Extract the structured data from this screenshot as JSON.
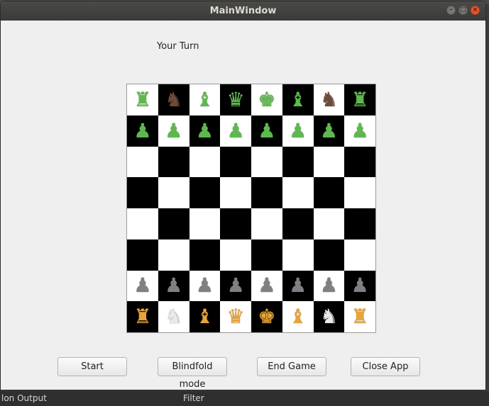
{
  "window": {
    "title": "MainWindow"
  },
  "status": {
    "turn": "Your Turn"
  },
  "buttons": {
    "start": "Start",
    "blindfold": "Blindfold mode",
    "end_game": "End Game",
    "close_app": "Close App"
  },
  "background": {
    "left_text": "lon Output",
    "filter_text": "Filter"
  },
  "colors": {
    "green_pieces": "#5fb84f",
    "gray_pieces": "#7f7f85",
    "orange_pieces": "#e6a43a",
    "dark_square": "#000000",
    "light_square": "#ffffff"
  },
  "board": {
    "rows": [
      [
        {
          "p": "rook",
          "c": "green"
        },
        {
          "p": "knight",
          "c": "brown"
        },
        {
          "p": "bishop",
          "c": "green"
        },
        {
          "p": "queen",
          "c": "green"
        },
        {
          "p": "king",
          "c": "green"
        },
        {
          "p": "bishop",
          "c": "green"
        },
        {
          "p": "knight",
          "c": "brown"
        },
        {
          "p": "rook",
          "c": "green"
        }
      ],
      [
        {
          "p": "pawn",
          "c": "green"
        },
        {
          "p": "pawn",
          "c": "green"
        },
        {
          "p": "pawn",
          "c": "green"
        },
        {
          "p": "pawn",
          "c": "green"
        },
        {
          "p": "pawn",
          "c": "green"
        },
        {
          "p": "pawn",
          "c": "green"
        },
        {
          "p": "pawn",
          "c": "green"
        },
        {
          "p": "pawn",
          "c": "green"
        }
      ],
      [
        null,
        null,
        null,
        null,
        null,
        null,
        null,
        null
      ],
      [
        null,
        null,
        null,
        null,
        null,
        null,
        null,
        null
      ],
      [
        null,
        null,
        null,
        null,
        null,
        null,
        null,
        null
      ],
      [
        null,
        null,
        null,
        null,
        null,
        null,
        null,
        null
      ],
      [
        {
          "p": "pawn",
          "c": "gray"
        },
        {
          "p": "pawn",
          "c": "gray"
        },
        {
          "p": "pawn",
          "c": "gray"
        },
        {
          "p": "pawn",
          "c": "gray"
        },
        {
          "p": "pawn",
          "c": "gray"
        },
        {
          "p": "pawn",
          "c": "gray"
        },
        {
          "p": "pawn",
          "c": "gray"
        },
        {
          "p": "pawn",
          "c": "gray"
        }
      ],
      [
        {
          "p": "rook",
          "c": "orange"
        },
        {
          "p": "knight",
          "c": "white"
        },
        {
          "p": "bishop",
          "c": "orange"
        },
        {
          "p": "queen",
          "c": "orange"
        },
        {
          "p": "king",
          "c": "orange"
        },
        {
          "p": "bishop",
          "c": "orange"
        },
        {
          "p": "knight",
          "c": "white"
        },
        {
          "p": "rook",
          "c": "orange"
        }
      ]
    ]
  }
}
